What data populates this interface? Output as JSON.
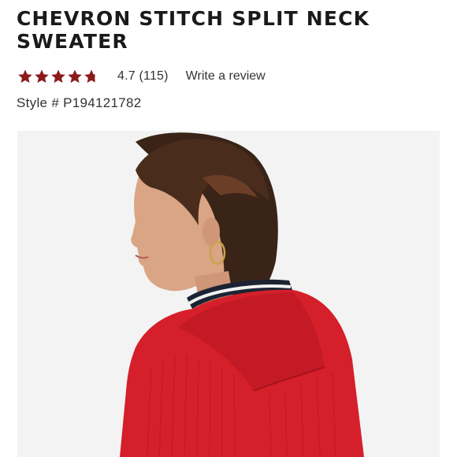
{
  "product": {
    "title": "CHEVRON STITCH SPLIT NECK SWEATER",
    "rating_value": "4.7",
    "review_count": "(115)",
    "rating_fraction": 0.94,
    "write_review_label": "Write a review",
    "style_number": "Style # P194121782"
  },
  "colors": {
    "star": "#8b1a1a",
    "sweater": "#d51f2a",
    "background": "#f3f3f3"
  },
  "icons": {
    "star": "star-icon"
  }
}
